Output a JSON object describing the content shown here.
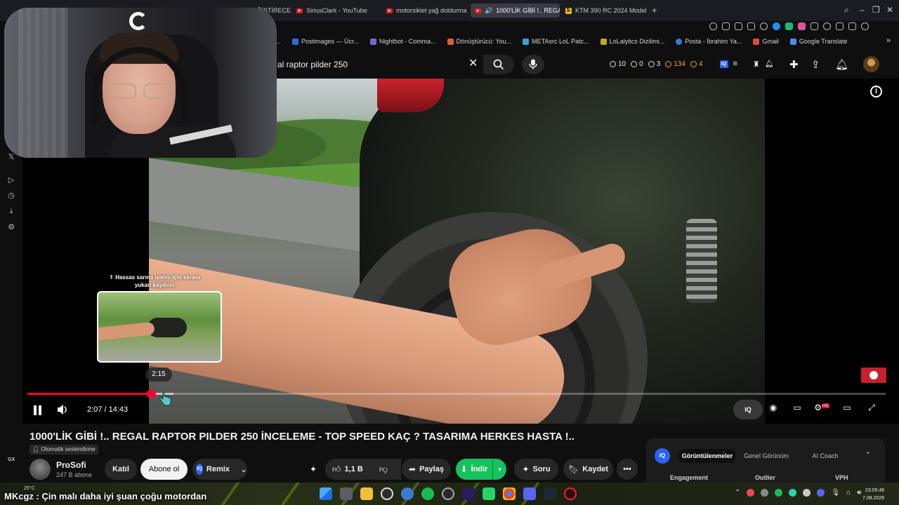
{
  "browser": {
    "tabs": [
      {
        "label": "D DEĞİŞTİRECE",
        "icon": "none"
      },
      {
        "label": "SiriusClark - YouTube",
        "icon": "youtube-favicon"
      },
      {
        "label": "motorsiklet yağ doldurma",
        "icon": "youtube-favicon"
      },
      {
        "label": "1000'LİK GİBİ !.. REGAL",
        "icon": "youtube-favicon",
        "active": true
      },
      {
        "label": "KTM 390 RC 2024 Model S",
        "icon": "s-favicon"
      }
    ],
    "s_favicon_letter": "S",
    "new_tab_label": "+",
    "bookmarks": [
      {
        "label": "am..."
      },
      {
        "label": "Postimages — Ücr..."
      },
      {
        "label": "Nightbot - Comma..."
      },
      {
        "label": "Dönüştürücü: You..."
      },
      {
        "label": "METAsrc LoL Patc..."
      },
      {
        "label": "LoLalytics Dizilimi..."
      },
      {
        "label": "Posta - İbrahim Ya..."
      },
      {
        "label": "Gmail"
      },
      {
        "label": "Google Translate"
      }
    ],
    "bookmarks_more": "»"
  },
  "header": {
    "search_query": "al raptor pilder 250",
    "clear_label": "✕",
    "stats": {
      "stat1": "10",
      "stat2": "0",
      "stat3": "3",
      "stat4": "134",
      "stat5": "4"
    },
    "iq_label": "IQ"
  },
  "player": {
    "seek_hint": "⇑ Hassas sarma işlemi için ekranı yukarı kaydırın",
    "hover_time": "2:15",
    "current_time": "2:07",
    "duration": "14:43",
    "time_separator": "/",
    "progress_fraction": 0.144,
    "buffered_fraction": 0.17,
    "info_label": "i",
    "iq_label": "IQ",
    "hd_label": "HD"
  },
  "video": {
    "title": "1000'LİK GİBİ !.. REGAL RAPTOR PILDER 250 İNCELEME - TOP SPEED KAÇ ? TASARIMA HERKES HASTA !..",
    "auto_dub": "Otomatik seslendirme",
    "channel_name": "ProSofi",
    "subscribers": "247 B abone",
    "join_label": "Katıl",
    "subscribe_label": "Abone ol",
    "remix_label": "Remix",
    "like_count": "1,1 B",
    "share_label": "Paylaş",
    "download_label": "İndir",
    "ask_label": "Soru",
    "save_label": "Kaydet",
    "more_label": "•••"
  },
  "iq_panel": {
    "logo": "IQ",
    "tabs": [
      "Görüntülenmeler",
      "Genel Görünüm",
      "AI Coach"
    ],
    "columns": [
      "Engagement",
      "Outlier",
      "VPH"
    ]
  },
  "sidebar": {
    "gx_label": "GX"
  },
  "taskbar": {
    "ticker": "MKcgz : Çin malı daha iyi şuan çoğu motordan",
    "temperature": "25°C",
    "time": "23:05:46",
    "date": "7.08.2026"
  },
  "colors": {
    "accent_red": "#ff0033",
    "download_green": "#16c25e",
    "iq_blue": "#2962ff"
  }
}
